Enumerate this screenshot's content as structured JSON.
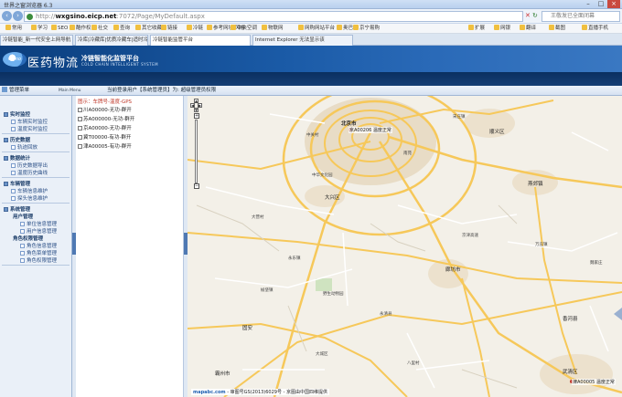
{
  "browser": {
    "title": "世界之窗浏览器 6.3",
    "url_prefix": "http://",
    "url_host": "wxgsino.eicp.net",
    "url_rest": ":7072/Page/MyDefault.aspx",
    "search_placeholder": "王敬发已全面闭幕",
    "favorites": [
      "常用",
      "学习",
      "SEO",
      "酷作权",
      "社交",
      "查询",
      "其它收藏",
      "链接",
      "冷链",
      "参考网址 风格",
      "中央空调",
      "物联网",
      "网购网站平台",
      "奥巴",
      "京宁易购",
      "扩展",
      "网银",
      "翻译",
      "截图",
      "直播手机"
    ],
    "tabs": [
      "冷链智能_新一代安全上网导航",
      "冷库|冷藏库|优质冷藏车|适时冷",
      "冷链智能监管平台",
      "Internet Explorer 无法显示该"
    ]
  },
  "app": {
    "logo_text": "Gsino",
    "name": "医药物流",
    "title": "冷链智能化监管平台",
    "subtitle": "COLD CHAIN INTELLIGENT SYSTEM",
    "menu_title": "管理菜单",
    "main_menu": "Main Menu",
    "user_info": "当前登录用户【系统管理员】为: 超级管理员权限"
  },
  "sidebar": {
    "sections": [
      {
        "title": "实时监控",
        "items": [
          "车辆实时监控",
          "温度实时监控"
        ]
      },
      {
        "title": "历史数据",
        "items": [
          "轨迹回放"
        ]
      },
      {
        "title": "数据统计",
        "items": [
          "历史数据导出",
          "温度历史曲线"
        ]
      },
      {
        "title": "车辆管理",
        "items": [
          "车辆信息维护",
          "探头信息维护"
        ]
      },
      {
        "title": "系统管理",
        "groups": [
          {
            "title": "用户管理",
            "items": [
              "单位信息管理",
              "用户信息管理"
            ]
          },
          {
            "title": "角色权限管理",
            "items": [
              "角色信息管理",
              "角色菜单管理",
              "角色权限管理"
            ]
          }
        ]
      }
    ]
  },
  "vehicle_list": {
    "header": "图示：车牌号-温度-GPS",
    "items": [
      "川A00000-无功-群开",
      "苏A000000-无功-群开",
      "京A00000-无功-群开",
      "冀T00000-有功-群开",
      "津A00005-有功-群开"
    ]
  },
  "map": {
    "places": [
      "北京市",
      "京A00206 温度正常",
      "中关村",
      "宋庄镇",
      "顺义区",
      "中华文化园",
      "大兴区",
      "大营村",
      "燕郊镇",
      "廊坊市",
      "永乐镇",
      "南苑",
      "榆垡镇",
      "固安",
      "永清县",
      "霸州市",
      "大城区",
      "京津高速",
      "万庄镇",
      "野生动物园",
      "八里村",
      "武清区",
      "香河县",
      "魏家庄",
      "津A00005 温度正常"
    ],
    "copyright_brand": "mapabc.com",
    "copyright_text": "- 审图号GS(2013)6029号 - 京图由中国四维提供"
  },
  "colors": {
    "header_blue": "#1a5aa6",
    "sidebar_bg": "#eaf0f8",
    "road_major": "#f6c85a",
    "road_minor": "#ffffff",
    "urban": "#e8dcc6",
    "vehicle_header": "#c0392b"
  }
}
